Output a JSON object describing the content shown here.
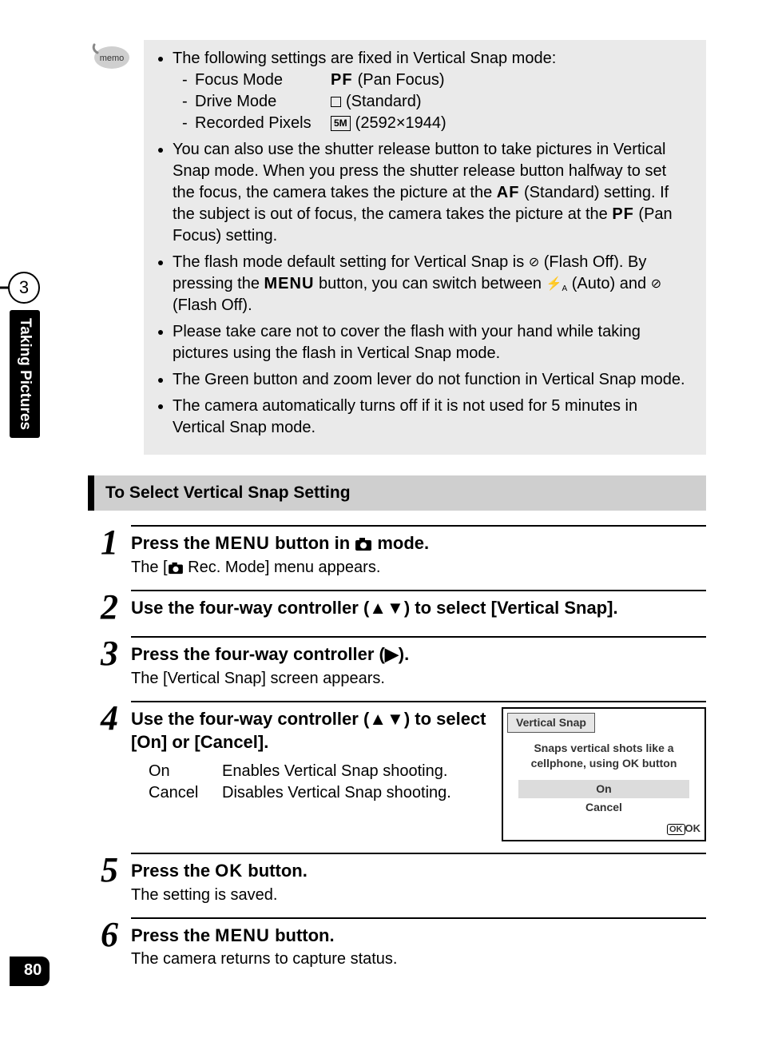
{
  "page_number": "80",
  "side_tab": {
    "number": "3",
    "label": "Taking Pictures"
  },
  "memo_badge": "memo",
  "memo": {
    "intro": "The following settings are fixed in Vertical Snap mode:",
    "settings": [
      {
        "label": "Focus Mode",
        "value_bold": "PF",
        "value_rest": "(Pan Focus)"
      },
      {
        "label": "Drive Mode",
        "value_bold": "",
        "value_rest": "(Standard)",
        "icon": "square"
      },
      {
        "label": "Recorded Pixels",
        "value_bold": "",
        "value_rest": "(2592×1944)",
        "icon": "5m"
      }
    ],
    "bullet2_a": "You can also use the shutter release button to take pictures in Vertical Snap mode. When you press the shutter release button halfway to set the focus, the camera takes the picture at the ",
    "bullet2_af": "AF",
    "bullet2_b": " (Standard) setting. If the subject is out of focus, the camera takes the picture at the ",
    "bullet2_pf": "PF",
    "bullet2_c": " (Pan Focus) setting.",
    "bullet3_a": "The flash mode default setting for Vertical Snap is ",
    "bullet3_off": " (Flash Off). By pressing the ",
    "bullet3_menu": "MENU",
    "bullet3_b": " button, you can switch between ",
    "bullet3_auto": " (Auto) and ",
    "bullet3_c": " (Flash Off).",
    "bullet4": "Please take care not to cover the flash with your hand while taking pictures using the flash in Vertical Snap mode.",
    "bullet5": "The Green button and zoom lever do not function in Vertical Snap mode.",
    "bullet6": "The camera automatically turns off if it is not used for 5 minutes in Vertical Snap mode."
  },
  "section_heading": "To Select Vertical Snap Setting",
  "steps": {
    "s1": {
      "n": "1",
      "title_a": "Press the ",
      "title_menu": "MENU",
      "title_b": " button in ",
      "title_c": " mode.",
      "desc_a": "The [",
      "desc_b": " Rec. Mode] menu appears."
    },
    "s2": {
      "n": "2",
      "title": "Use the four-way controller (▲▼) to select [Vertical Snap]."
    },
    "s3": {
      "n": "3",
      "title": "Press the four-way controller (▶).",
      "desc": "The [Vertical Snap] screen appears."
    },
    "s4": {
      "n": "4",
      "title": "Use the four-way controller (▲▼) to select [On] or [Cancel].",
      "opts": {
        "on_k": "On",
        "on_v": "Enables Vertical Snap shooting.",
        "cancel_k": "Cancel",
        "cancel_v": "Disables Vertical Snap shooting."
      }
    },
    "s5": {
      "n": "5",
      "title_a": "Press the ",
      "title_ok": "OK",
      "title_b": " button.",
      "desc": "The setting is saved."
    },
    "s6": {
      "n": "6",
      "title_a": "Press the ",
      "title_menu": "MENU",
      "title_b": " button.",
      "desc": "The camera returns to capture status."
    }
  },
  "lcd": {
    "tab": "Vertical Snap",
    "desc_l1": "Snaps vertical shots like a",
    "desc_l2": "cellphone, using OK button",
    "opt_on": "On",
    "opt_cancel": "Cancel",
    "foot_ok": "OK",
    "foot_ok_btn": "OK"
  },
  "icons": {
    "five_m": "5M"
  }
}
